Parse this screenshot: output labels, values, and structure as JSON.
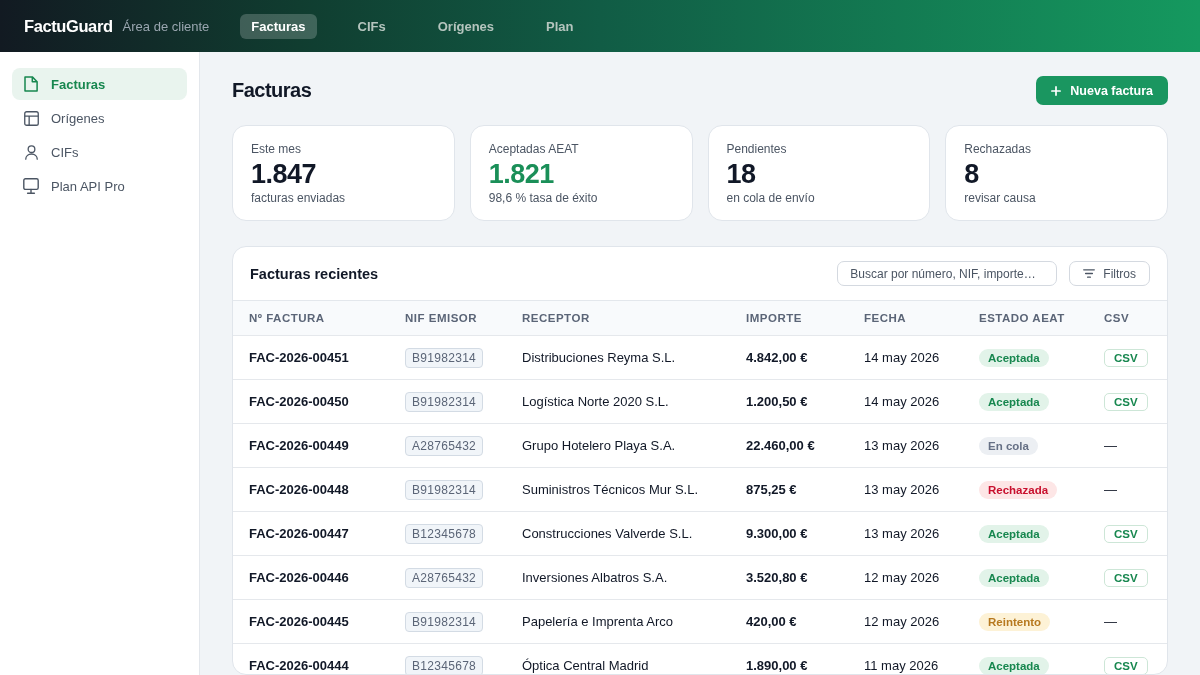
{
  "app": {
    "logo": "FactuGuard",
    "subtitle": "Área de cliente"
  },
  "nav": [
    {
      "label": "Facturas",
      "selected": true
    },
    {
      "label": "CIFs",
      "selected": false
    },
    {
      "label": "Orígenes",
      "selected": false
    },
    {
      "label": "Plan",
      "selected": false
    }
  ],
  "sidebar": {
    "items": [
      {
        "label": "Facturas",
        "selected": true
      },
      {
        "label": "Orígenes",
        "selected": false
      },
      {
        "label": "CIFs",
        "selected": false
      },
      {
        "label": "Plan API Pro",
        "selected": false
      }
    ]
  },
  "page": {
    "title": "Facturas",
    "new_button": "Nueva factura"
  },
  "stats": [
    {
      "label": "Este mes",
      "value": "1.847",
      "caption": "facturas enviadas",
      "accent": false
    },
    {
      "label": "Aceptadas AEAT",
      "value": "1.821",
      "caption": "98,6 % tasa de éxito",
      "accent": true
    },
    {
      "label": "Pendientes",
      "value": "18",
      "caption": "en cola de envío",
      "accent": false
    },
    {
      "label": "Rechazadas",
      "value": "8",
      "caption": "revisar causa",
      "accent": false
    }
  ],
  "table": {
    "title": "Facturas recientes",
    "search": {
      "placeholder": "Buscar por número, NIF, importe…"
    },
    "filter_button": "Filtros",
    "columns": [
      "Nº FACTURA",
      "NIF EMISOR",
      "RECEPTOR",
      "IMPORTE",
      "FECHA",
      "ESTADO AEAT",
      "CSV"
    ],
    "rows": [
      {
        "invoice": "FAC-2026-00451",
        "issuer_nif": "B91982314",
        "recipient": "Distribuciones Reyma S.L.",
        "amount": "4.842,00 €",
        "date": "14 may 2026",
        "status": {
          "label": "Aceptada",
          "kind": "accepted"
        },
        "csv": {
          "kind": "button",
          "label": "CSV"
        }
      },
      {
        "invoice": "FAC-2026-00450",
        "issuer_nif": "B91982314",
        "recipient": "Logística Norte 2020 S.L.",
        "amount": "1.200,50 €",
        "date": "14 may 2026",
        "status": {
          "label": "Aceptada",
          "kind": "accepted"
        },
        "csv": {
          "kind": "button",
          "label": "CSV"
        }
      },
      {
        "invoice": "FAC-2026-00449",
        "issuer_nif": "A28765432",
        "recipient": "Grupo Hotelero Playa S.A.",
        "amount": "22.460,00 €",
        "date": "13 may 2026",
        "status": {
          "label": "En cola",
          "kind": "queued"
        },
        "csv": {
          "kind": "empty",
          "label": "—"
        }
      },
      {
        "invoice": "FAC-2026-00448",
        "issuer_nif": "B91982314",
        "recipient": "Suministros Técnicos Mur S.L.",
        "amount": "875,25 €",
        "date": "13 may 2026",
        "status": {
          "label": "Rechazada",
          "kind": "rejected"
        },
        "csv": {
          "kind": "empty",
          "label": "—"
        }
      },
      {
        "invoice": "FAC-2026-00447",
        "issuer_nif": "B12345678",
        "recipient": "Construcciones Valverde S.L.",
        "amount": "9.300,00 €",
        "date": "13 may 2026",
        "status": {
          "label": "Aceptada",
          "kind": "accepted"
        },
        "csv": {
          "kind": "button",
          "label": "CSV"
        }
      },
      {
        "invoice": "FAC-2026-00446",
        "issuer_nif": "A28765432",
        "recipient": "Inversiones Albatros S.A.",
        "amount": "3.520,80 €",
        "date": "12 may 2026",
        "status": {
          "label": "Aceptada",
          "kind": "accepted"
        },
        "csv": {
          "kind": "button",
          "label": "CSV"
        }
      },
      {
        "invoice": "FAC-2026-00445",
        "issuer_nif": "B91982314",
        "recipient": "Papelería e Imprenta Arco",
        "amount": "420,00 €",
        "date": "12 may 2026",
        "status": {
          "label": "Reintento",
          "kind": "retry"
        },
        "csv": {
          "kind": "empty",
          "label": "—"
        }
      },
      {
        "invoice": "FAC-2026-00444",
        "issuer_nif": "B12345678",
        "recipient": "Óptica Central Madrid",
        "amount": "1.890,00 €",
        "date": "11 may 2026",
        "status": {
          "label": "Aceptada",
          "kind": "accepted"
        },
        "csv": {
          "kind": "button",
          "label": "CSV"
        }
      }
    ]
  }
}
